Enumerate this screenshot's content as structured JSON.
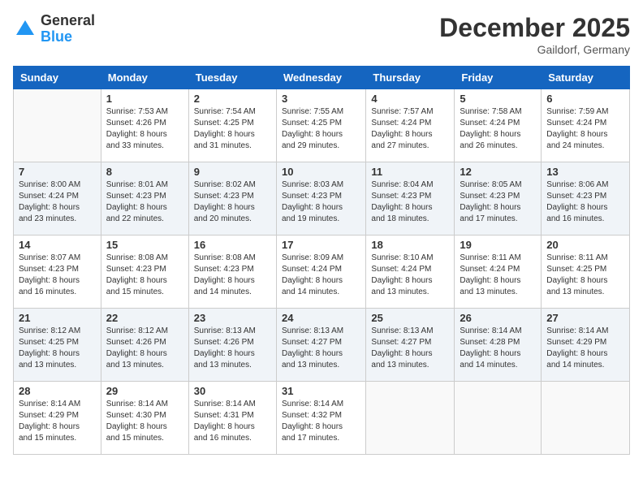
{
  "logo": {
    "general": "General",
    "blue": "Blue"
  },
  "title": "December 2025",
  "location": "Gaildorf, Germany",
  "days_header": [
    "Sunday",
    "Monday",
    "Tuesday",
    "Wednesday",
    "Thursday",
    "Friday",
    "Saturday"
  ],
  "weeks": [
    [
      {
        "day": "",
        "info": ""
      },
      {
        "day": "1",
        "info": "Sunrise: 7:53 AM\nSunset: 4:26 PM\nDaylight: 8 hours\nand 33 minutes."
      },
      {
        "day": "2",
        "info": "Sunrise: 7:54 AM\nSunset: 4:25 PM\nDaylight: 8 hours\nand 31 minutes."
      },
      {
        "day": "3",
        "info": "Sunrise: 7:55 AM\nSunset: 4:25 PM\nDaylight: 8 hours\nand 29 minutes."
      },
      {
        "day": "4",
        "info": "Sunrise: 7:57 AM\nSunset: 4:24 PM\nDaylight: 8 hours\nand 27 minutes."
      },
      {
        "day": "5",
        "info": "Sunrise: 7:58 AM\nSunset: 4:24 PM\nDaylight: 8 hours\nand 26 minutes."
      },
      {
        "day": "6",
        "info": "Sunrise: 7:59 AM\nSunset: 4:24 PM\nDaylight: 8 hours\nand 24 minutes."
      }
    ],
    [
      {
        "day": "7",
        "info": ""
      },
      {
        "day": "8",
        "info": "Sunrise: 8:01 AM\nSunset: 4:23 PM\nDaylight: 8 hours\nand 22 minutes."
      },
      {
        "day": "9",
        "info": "Sunrise: 8:02 AM\nSunset: 4:23 PM\nDaylight: 8 hours\nand 20 minutes."
      },
      {
        "day": "10",
        "info": "Sunrise: 8:03 AM\nSunset: 4:23 PM\nDaylight: 8 hours\nand 19 minutes."
      },
      {
        "day": "11",
        "info": "Sunrise: 8:04 AM\nSunset: 4:23 PM\nDaylight: 8 hours\nand 18 minutes."
      },
      {
        "day": "12",
        "info": "Sunrise: 8:05 AM\nSunset: 4:23 PM\nDaylight: 8 hours\nand 17 minutes."
      },
      {
        "day": "13",
        "info": "Sunrise: 8:06 AM\nSunset: 4:23 PM\nDaylight: 8 hours\nand 16 minutes."
      }
    ],
    [
      {
        "day": "14",
        "info": ""
      },
      {
        "day": "15",
        "info": "Sunrise: 8:08 AM\nSunset: 4:23 PM\nDaylight: 8 hours\nand 15 minutes."
      },
      {
        "day": "16",
        "info": "Sunrise: 8:08 AM\nSunset: 4:23 PM\nDaylight: 8 hours\nand 14 minutes."
      },
      {
        "day": "17",
        "info": "Sunrise: 8:09 AM\nSunset: 4:24 PM\nDaylight: 8 hours\nand 14 minutes."
      },
      {
        "day": "18",
        "info": "Sunrise: 8:10 AM\nSunset: 4:24 PM\nDaylight: 8 hours\nand 13 minutes."
      },
      {
        "day": "19",
        "info": "Sunrise: 8:11 AM\nSunset: 4:24 PM\nDaylight: 8 hours\nand 13 minutes."
      },
      {
        "day": "20",
        "info": "Sunrise: 8:11 AM\nSunset: 4:25 PM\nDaylight: 8 hours\nand 13 minutes."
      }
    ],
    [
      {
        "day": "21",
        "info": ""
      },
      {
        "day": "22",
        "info": "Sunrise: 8:12 AM\nSunset: 4:26 PM\nDaylight: 8 hours\nand 13 minutes."
      },
      {
        "day": "23",
        "info": "Sunrise: 8:13 AM\nSunset: 4:26 PM\nDaylight: 8 hours\nand 13 minutes."
      },
      {
        "day": "24",
        "info": "Sunrise: 8:13 AM\nSunset: 4:27 PM\nDaylight: 8 hours\nand 13 minutes."
      },
      {
        "day": "25",
        "info": "Sunrise: 8:13 AM\nSunset: 4:27 PM\nDaylight: 8 hours\nand 13 minutes."
      },
      {
        "day": "26",
        "info": "Sunrise: 8:14 AM\nSunset: 4:28 PM\nDaylight: 8 hours\nand 14 minutes."
      },
      {
        "day": "27",
        "info": "Sunrise: 8:14 AM\nSunset: 4:29 PM\nDaylight: 8 hours\nand 14 minutes."
      }
    ],
    [
      {
        "day": "28",
        "info": "Sunrise: 8:14 AM\nSunset: 4:29 PM\nDaylight: 8 hours\nand 15 minutes."
      },
      {
        "day": "29",
        "info": "Sunrise: 8:14 AM\nSunset: 4:30 PM\nDaylight: 8 hours\nand 15 minutes."
      },
      {
        "day": "30",
        "info": "Sunrise: 8:14 AM\nSunset: 4:31 PM\nDaylight: 8 hours\nand 16 minutes."
      },
      {
        "day": "31",
        "info": "Sunrise: 8:14 AM\nSunset: 4:32 PM\nDaylight: 8 hours\nand 17 minutes."
      },
      {
        "day": "",
        "info": ""
      },
      {
        "day": "",
        "info": ""
      },
      {
        "day": "",
        "info": ""
      }
    ]
  ],
  "week7_sun": "Sunrise: 8:00 AM\nSunset: 4:24 PM\nDaylight: 8 hours\nand 23 minutes.",
  "week14_sun": "Sunrise: 8:07 AM\nSunset: 4:23 PM\nDaylight: 8 hours\nand 16 minutes.",
  "week21_sun": "Sunrise: 8:12 AM\nSunset: 4:25 PM\nDaylight: 8 hours\nand 13 minutes."
}
